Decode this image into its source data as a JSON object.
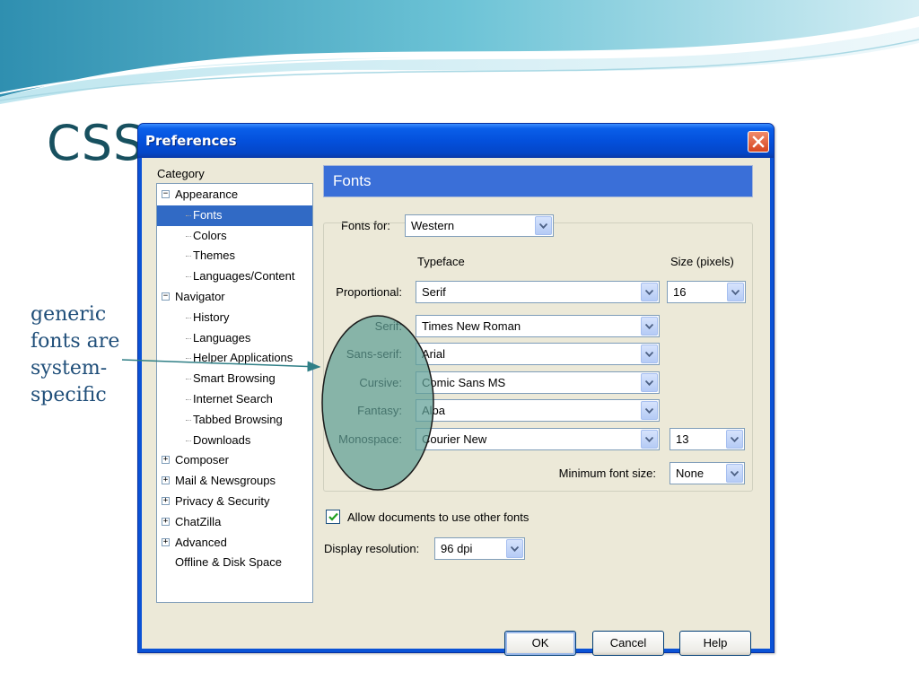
{
  "slide": {
    "title": "CSS",
    "side_note_lines": [
      "generic",
      "fonts are",
      "system-",
      "specific"
    ]
  },
  "dialog": {
    "title": "Preferences",
    "category_label": "Category",
    "tree": [
      {
        "label": "Appearance",
        "level": 0,
        "expander": "⊟"
      },
      {
        "label": "Fonts",
        "level": 1,
        "selected": true
      },
      {
        "label": "Colors",
        "level": 1
      },
      {
        "label": "Themes",
        "level": 1
      },
      {
        "label": "Languages/Content",
        "level": 1
      },
      {
        "label": "Navigator",
        "level": 0,
        "expander": "⊟"
      },
      {
        "label": "History",
        "level": 1
      },
      {
        "label": "Languages",
        "level": 1
      },
      {
        "label": "Helper Applications",
        "level": 1
      },
      {
        "label": "Smart Browsing",
        "level": 1
      },
      {
        "label": "Internet Search",
        "level": 1
      },
      {
        "label": "Tabbed Browsing",
        "level": 1
      },
      {
        "label": "Downloads",
        "level": 1
      },
      {
        "label": "Composer",
        "level": 0,
        "expander": "⊞"
      },
      {
        "label": "Mail & Newsgroups",
        "level": 0,
        "expander": "⊞"
      },
      {
        "label": "Privacy & Security",
        "level": 0,
        "expander": "⊞"
      },
      {
        "label": "ChatZilla",
        "level": 0,
        "expander": "⊞"
      },
      {
        "label": "Advanced",
        "level": 0,
        "expander": "⊞"
      },
      {
        "label": "Offline & Disk Space",
        "level": 0
      }
    ],
    "panel_header": "Fonts",
    "fonts_for_label": "Fonts for:",
    "fonts_for_value": "Western",
    "typeface_header": "Typeface",
    "size_header": "Size (pixels)",
    "rows": {
      "proportional": {
        "label": "Proportional:",
        "value": "Serif",
        "size": "16"
      },
      "serif": {
        "label": "Serif:",
        "value": "Times New Roman"
      },
      "sans_serif": {
        "label": "Sans-serif:",
        "value": "Arial"
      },
      "cursive": {
        "label": "Cursive:",
        "value": "Comic Sans MS"
      },
      "fantasy": {
        "label": "Fantasy:",
        "value": "Alba"
      },
      "monospace": {
        "label": "Monospace:",
        "value": "Courier New",
        "size": "13"
      }
    },
    "min_font_label": "Minimum font size:",
    "min_font_value": "None",
    "allow_docs_label": "Allow documents to use other fonts",
    "allow_docs_checked": true,
    "display_res_label": "Display resolution:",
    "display_res_value": "96 dpi",
    "buttons": {
      "ok": "OK",
      "cancel": "Cancel",
      "help": "Help"
    }
  },
  "colors": {
    "title_text": "#17505f",
    "note_text": "#1f4e79",
    "annotation_fill": "#5f9f95",
    "selection": "#316ac5",
    "titlebar": "#0450dc"
  },
  "icons": {
    "close": "close-icon",
    "dropdown": "chevron-down-icon",
    "check": "checkmark-icon"
  }
}
